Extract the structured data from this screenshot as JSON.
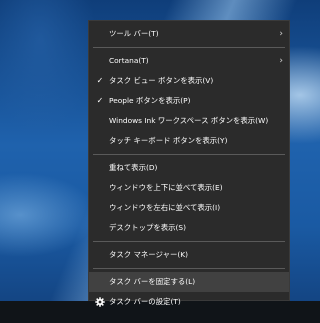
{
  "menu": {
    "groups": [
      {
        "items": [
          {
            "label": "ツール バー(T)",
            "submenu": true
          }
        ]
      },
      {
        "items": [
          {
            "label": "Cortana(T)",
            "submenu": true
          },
          {
            "label": "タスク ビュー ボタンを表示(V)",
            "checked": true
          },
          {
            "label": "People ボタンを表示(P)",
            "checked": true
          },
          {
            "label": "Windows Ink ワークスペース ボタンを表示(W)"
          },
          {
            "label": "タッチ キーボード ボタンを表示(Y)"
          }
        ]
      },
      {
        "items": [
          {
            "label": "重ねて表示(D)"
          },
          {
            "label": "ウィンドウを上下に並べて表示(E)"
          },
          {
            "label": "ウィンドウを左右に並べて表示(I)"
          },
          {
            "label": "デスクトップを表示(S)"
          }
        ]
      },
      {
        "items": [
          {
            "label": "タスク マネージャー(K)"
          }
        ]
      },
      {
        "items": [
          {
            "label": "タスク バーを固定する(L)",
            "highlighted": true
          },
          {
            "label": "タスク バーの設定(T)",
            "icon": "gear-icon"
          }
        ]
      }
    ]
  },
  "icons": {
    "check": "✓",
    "chevron": "›"
  },
  "colors": {
    "menu_background": "#2b2b2b",
    "menu_hover": "#414141",
    "separator": "#5a5a5a",
    "text": "#ffffff"
  }
}
